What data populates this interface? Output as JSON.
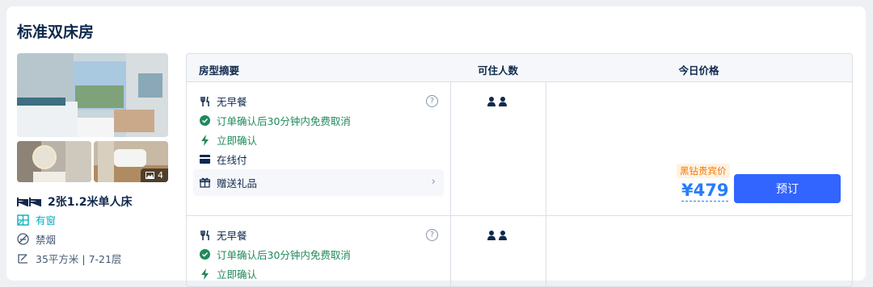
{
  "room": {
    "title": "标准双床房",
    "photo_count": "4",
    "bed": "2张1.2米单人床",
    "window": "有窗",
    "smoking": "禁烟",
    "size_floor": "35平方米 | 7-21层"
  },
  "table": {
    "headers": {
      "summary": "房型摘要",
      "guests": "可住人数",
      "price": "今日价格"
    },
    "offers": [
      {
        "meal": "无早餐",
        "cancel": "订单确认后30分钟内免费取消",
        "confirm": "立即确认",
        "payment": "在线付",
        "gift": "赠送礼品",
        "vip_label": "黑钻贵宾价",
        "price": "¥479",
        "book_label": "预订"
      },
      {
        "meal": "无早餐",
        "cancel": "订单确认后30分钟内免费取消",
        "confirm": "立即确认"
      }
    ]
  },
  "colors": {
    "accent": "#3264ff",
    "price": "#287dfa",
    "green": "#1f8a5b",
    "vip": "#f57a00"
  }
}
